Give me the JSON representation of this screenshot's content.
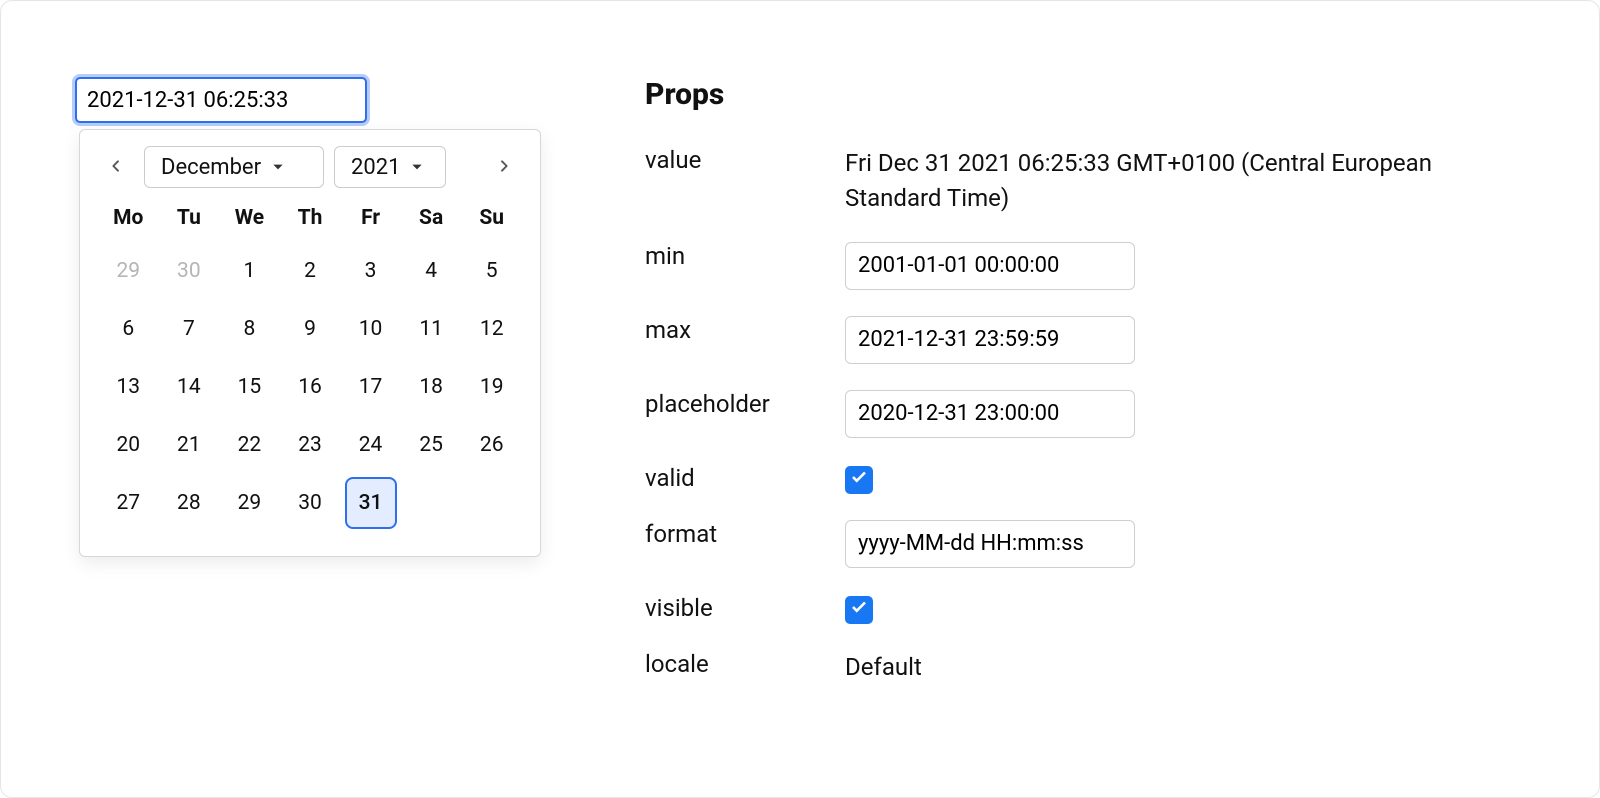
{
  "datepicker": {
    "input_value": "2021-12-31 06:25:33",
    "month_label": "December",
    "year_label": "2021",
    "weekdays": [
      "Mo",
      "Tu",
      "We",
      "Th",
      "Fr",
      "Sa",
      "Su"
    ],
    "days": [
      {
        "n": "29",
        "out": true
      },
      {
        "n": "30",
        "out": true
      },
      {
        "n": "1"
      },
      {
        "n": "2"
      },
      {
        "n": "3"
      },
      {
        "n": "4"
      },
      {
        "n": "5"
      },
      {
        "n": "6"
      },
      {
        "n": "7"
      },
      {
        "n": "8"
      },
      {
        "n": "9"
      },
      {
        "n": "10"
      },
      {
        "n": "11"
      },
      {
        "n": "12"
      },
      {
        "n": "13"
      },
      {
        "n": "14"
      },
      {
        "n": "15"
      },
      {
        "n": "16"
      },
      {
        "n": "17"
      },
      {
        "n": "18"
      },
      {
        "n": "19"
      },
      {
        "n": "20"
      },
      {
        "n": "21"
      },
      {
        "n": "22"
      },
      {
        "n": "23"
      },
      {
        "n": "24"
      },
      {
        "n": "25"
      },
      {
        "n": "26"
      },
      {
        "n": "27"
      },
      {
        "n": "28"
      },
      {
        "n": "29"
      },
      {
        "n": "30"
      },
      {
        "n": "31",
        "selected": true
      }
    ]
  },
  "props": {
    "title": "Props",
    "labels": {
      "value": "value",
      "min": "min",
      "max": "max",
      "placeholder": "placeholder",
      "valid": "valid",
      "format": "format",
      "visible": "visible",
      "locale": "locale"
    },
    "value_text": "Fri Dec 31 2021 06:25:33 GMT+0100 (Central European Standard Time)",
    "min": "2001-01-01 00:00:00",
    "max": "2021-12-31 23:59:59",
    "placeholder": "2020-12-31 23:00:00",
    "valid": true,
    "format": "yyyy-MM-dd HH:mm:ss",
    "visible": true,
    "locale": "Default"
  }
}
